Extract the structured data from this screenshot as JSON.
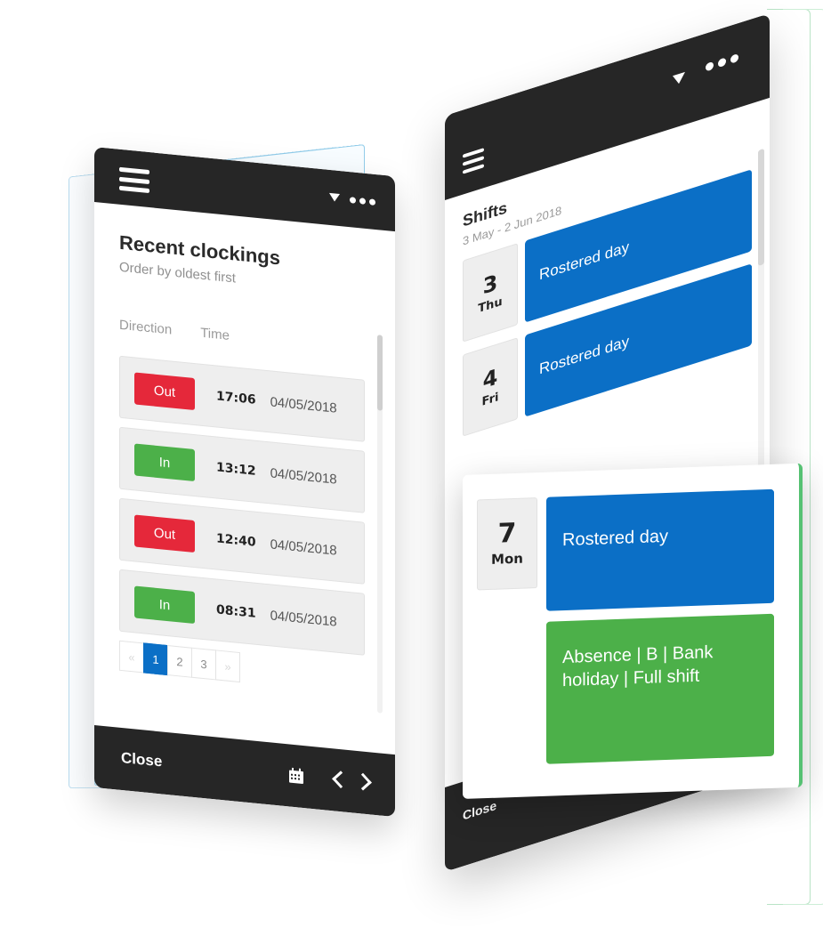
{
  "left_panel": {
    "title": "Recent clockings",
    "subtitle": "Order by oldest first",
    "columns": [
      "Direction",
      "Time"
    ],
    "rows": [
      {
        "direction": "Out",
        "type": "out",
        "time": "17:06",
        "date": "04/05/2018"
      },
      {
        "direction": "In",
        "type": "in",
        "time": "13:12",
        "date": "04/05/2018"
      },
      {
        "direction": "Out",
        "type": "out",
        "time": "12:40",
        "date": "04/05/2018"
      },
      {
        "direction": "In",
        "type": "in",
        "time": "08:31",
        "date": "04/05/2018"
      }
    ],
    "pagination": {
      "prev": "«",
      "pages": [
        "1",
        "2",
        "3"
      ],
      "current": "1",
      "next": "»"
    },
    "footer": {
      "close_label": "Close"
    }
  },
  "right_panel": {
    "title": "Shifts",
    "subtitle": "3 May - 2 Jun 2018",
    "days": [
      {
        "num": "3",
        "dow": "Thu",
        "shift": "Rostered day"
      },
      {
        "num": "4",
        "dow": "Fri",
        "shift": "Rostered day"
      }
    ],
    "expanded_day": {
      "num": "7",
      "dow": "Mon",
      "shifts": [
        "Rostered day",
        "Absence | B | Bank holiday | Full shift"
      ]
    },
    "footer": {
      "close_label": "Close"
    }
  },
  "icons": {
    "menu": "hamburger-icon",
    "dropdown": "caret-down-icon",
    "more": "more-dots-icon",
    "calendar": "calendar-icon",
    "prev": "chevron-left-icon",
    "next": "chevron-right-icon"
  },
  "colors": {
    "header_bg": "#262626",
    "out_red": "#e5283a",
    "in_green": "#4cb049",
    "shift_blue": "#0b6fc6",
    "accent_green": "#56c173"
  }
}
